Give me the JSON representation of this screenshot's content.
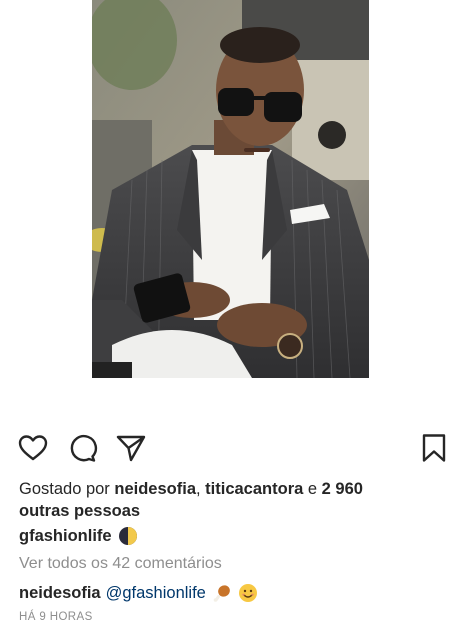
{
  "post": {
    "photo_alt": "man-in-pinstripe-suit-with-sunglasses-holding-phone",
    "icons": {
      "like": "heart-icon",
      "comment": "comment-bubble-icon",
      "share": "paper-plane-icon",
      "save": "bookmark-icon"
    },
    "likes": {
      "prefix": "Gostado por ",
      "user1": "neidesofia",
      "sep": ", ",
      "user2": "titicacantora",
      "mid": " e ",
      "count": "2 960",
      "suffix": "outras pessoas"
    },
    "caption": {
      "username": "gfashionlife",
      "emoji": "first-quarter-moon-emoji"
    },
    "view_comments": "Ver todos os 42 comentários",
    "comment": {
      "username": "neidesofia",
      "mention": "@gfashionlife",
      "emojis": [
        "poultry-leg-emoji",
        "smiling-face-emoji"
      ]
    },
    "time_ago": "HÁ 9 HORAS"
  },
  "colors": {
    "text": "#262626",
    "muted": "#8e8e8e",
    "mention": "#00376b"
  }
}
